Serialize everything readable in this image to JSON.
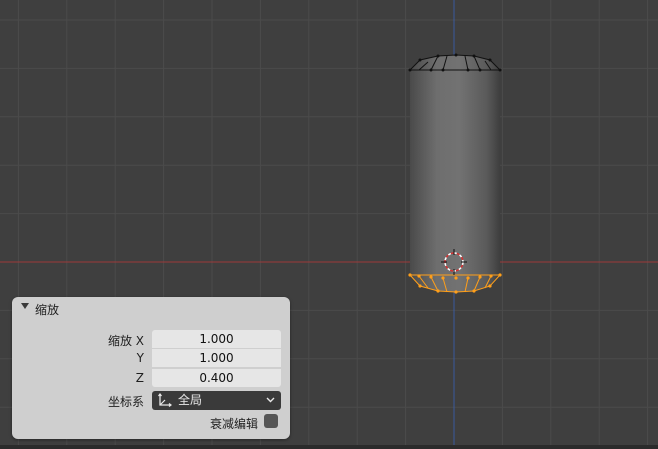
{
  "panel": {
    "title": "缩放",
    "fields": {
      "x_label": "缩放 X",
      "x_value": "1.000",
      "y_label": "Y",
      "y_value": "1.000",
      "z_label": "Z",
      "z_value": "0.400"
    },
    "orientation": {
      "label": "坐标系",
      "value": "全局",
      "icon": "axis-icon"
    },
    "proportional": {
      "label": "衰减编辑",
      "checked": false
    }
  },
  "colors": {
    "viewport_bg": "#3f3f3f",
    "grid_line": "#4c4c4c",
    "x_axis": "#9d3a3a",
    "z_axis": "#3a5a9d",
    "selected": "#ff9f1a",
    "wire": "#111111"
  }
}
